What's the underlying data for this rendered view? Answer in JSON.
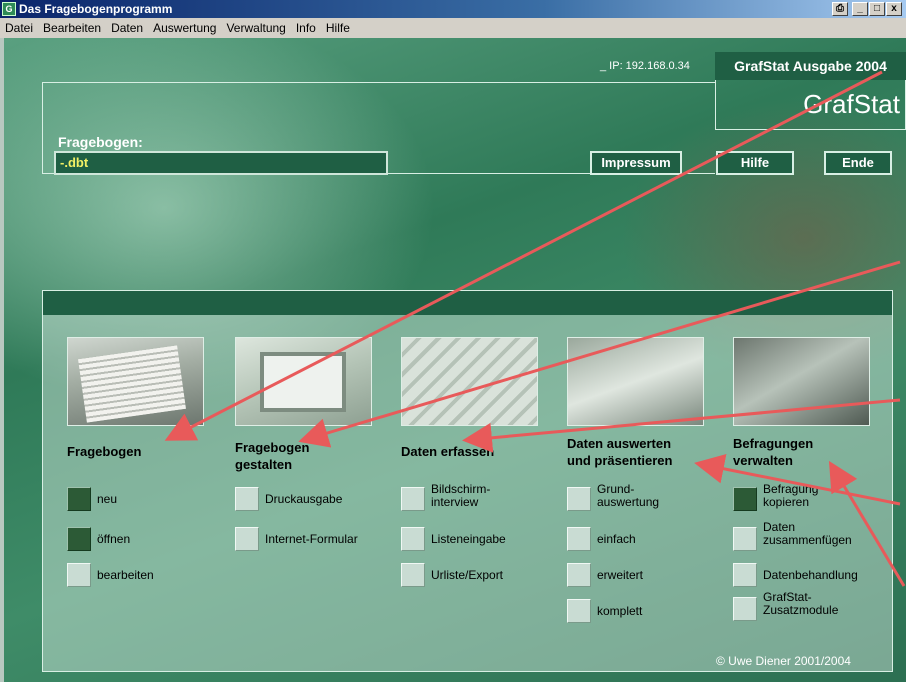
{
  "window": {
    "title": "Das Fragebogenprogramm",
    "app_icon": "G",
    "controls": [
      "_",
      "□",
      "x"
    ]
  },
  "menu": [
    "Datei",
    "Bearbeiten",
    "Daten",
    "Auswertung",
    "Verwaltung",
    "Info",
    "Hilfe"
  ],
  "header": {
    "ip_text": "_   IP: 192.168.0.34",
    "brand_edition": "GrafStat Ausgabe 2004",
    "brand_name": "GrafStat",
    "fragebogen_label": "Fragebogen:",
    "fragebogen_value": "-.dbt",
    "buttons": {
      "impressum": "Impressum",
      "hilfe": "Hilfe",
      "ende": "Ende"
    }
  },
  "columns": [
    {
      "title_line1": "Fragebogen",
      "title_line2": "",
      "image": "questionnaire-photo",
      "options": [
        {
          "label1": "neu",
          "label2": "",
          "active": true
        },
        {
          "label1": "öffnen",
          "label2": "",
          "active": true
        },
        {
          "label1": "bearbeiten",
          "label2": "",
          "active": false
        }
      ]
    },
    {
      "title_line1": "Fragebogen",
      "title_line2": "gestalten",
      "image": "computer-photo",
      "options": [
        {
          "label1": "Druckausgabe",
          "label2": "",
          "active": false
        },
        {
          "label1": "Internet-Formular",
          "label2": "",
          "active": false
        }
      ]
    },
    {
      "title_line1": "Daten erfassen",
      "title_line2": "",
      "image": "keyboard-photo",
      "options": [
        {
          "label1": "Bildschirm-",
          "label2": "interview",
          "active": false
        },
        {
          "label1": "Listeneingabe",
          "label2": "",
          "active": false
        },
        {
          "label1": "Urliste/Export",
          "label2": "",
          "active": false
        }
      ]
    },
    {
      "title_line1": "Daten auswerten",
      "title_line2": "und präsentieren",
      "image": "presentation-photo",
      "options": [
        {
          "label1": "Grund-",
          "label2": "auswertung",
          "active": false
        },
        {
          "label1": "einfach",
          "label2": "",
          "active": false
        },
        {
          "label1": "erweitert",
          "label2": "",
          "active": false
        },
        {
          "label1": "komplett",
          "label2": "",
          "active": false
        }
      ]
    },
    {
      "title_line1": "Befragungen",
      "title_line2": "verwalten",
      "image": "atm-card-photo",
      "options": [
        {
          "label1": "Befragung",
          "label2": "kopieren",
          "active": true
        },
        {
          "label1": "Daten",
          "label2": "zusammenfügen",
          "active": false
        },
        {
          "label1": "Datenbehandlung",
          "label2": "",
          "active": false
        },
        {
          "label1": "GrafStat-",
          "label2": "Zusatzmodule",
          "active": false
        }
      ]
    }
  ],
  "footer": {
    "copyright": "© Uwe Diener 2001/2004"
  },
  "colors": {
    "panel_dark": "#1f5f44",
    "field_text": "#f3f065",
    "arrow": "#e85a5a",
    "option_active": "#2c5a36"
  }
}
